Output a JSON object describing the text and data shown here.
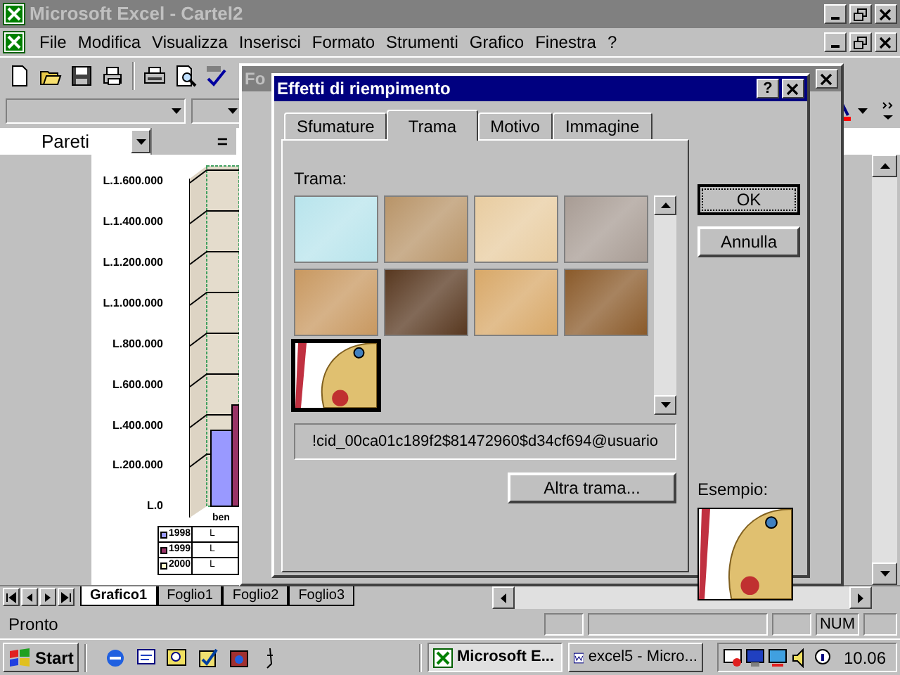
{
  "app_window": {
    "title": "Microsoft Excel - Cartel2"
  },
  "menu_bar": [
    "File",
    "Modifica",
    "Visualizza",
    "Inserisci",
    "Formato",
    "Strumenti",
    "Grafico",
    "Finestra",
    "?"
  ],
  "name_box": {
    "value": "Pareti"
  },
  "formula_bar": {
    "equals": "="
  },
  "chart": {
    "axis_labels": [
      "L.1.600.000",
      "L.1.400.000",
      "L.1.200.000",
      "L.1.000.000",
      "L.800.000",
      "L.600.000",
      "L.400.000",
      "L.200.000",
      "L.0"
    ],
    "category_label": "ben",
    "legend": [
      {
        "label": "1998",
        "cell": "L"
      },
      {
        "label": "1999",
        "cell": "L"
      },
      {
        "label": "2000",
        "cell": "L"
      }
    ]
  },
  "back_dialog": {
    "title": "Fo"
  },
  "dialog": {
    "title": "Effetti di riempimento",
    "help": "?",
    "tabs": [
      {
        "label": "Sfumature",
        "selected": false
      },
      {
        "label": "Trama",
        "selected": true
      },
      {
        "label": "Motivo",
        "selected": false
      },
      {
        "label": "Immagine",
        "selected": false
      }
    ],
    "texture_label": "Trama:",
    "textures": [
      {
        "selected": false
      },
      {
        "selected": false
      },
      {
        "selected": false
      },
      {
        "selected": false
      },
      {
        "selected": false
      },
      {
        "selected": false
      },
      {
        "selected": false
      },
      {
        "selected": false
      },
      {
        "selected": true
      }
    ],
    "texture_name": "!cid_00ca01c189f2$81472960$d34cf694@usuario",
    "other_button": "Altra trama...",
    "ok": "OK",
    "cancel": "Annulla",
    "preview_label": "Esempio:"
  },
  "sheet_tabs": [
    {
      "label": "Grafico1",
      "selected": true
    },
    {
      "label": "Foglio1",
      "selected": false
    },
    {
      "label": "Foglio2",
      "selected": false
    },
    {
      "label": "Foglio3",
      "selected": false
    }
  ],
  "status_bar": {
    "text": "Pronto",
    "indicator": "NUM"
  },
  "taskbar": {
    "start": "Start",
    "tasks": [
      {
        "label": "Microsoft E...",
        "selected": true
      },
      {
        "label": "excel5 - Micro...",
        "selected": false
      }
    ],
    "clock": "10.06"
  }
}
